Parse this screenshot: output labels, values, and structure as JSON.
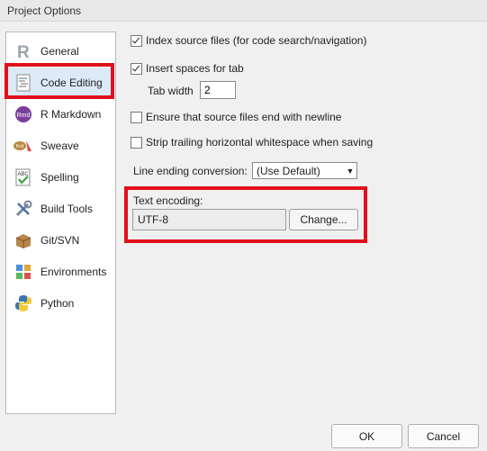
{
  "window": {
    "title": "Project Options"
  },
  "sidebar": {
    "items": [
      {
        "label": "General",
        "icon": "r-logo-icon"
      },
      {
        "label": "Code Editing",
        "icon": "code-document-icon",
        "selected": true
      },
      {
        "label": "R Markdown",
        "icon": "rmd-icon"
      },
      {
        "label": "Sweave",
        "icon": "sweave-icon"
      },
      {
        "label": "Spelling",
        "icon": "spellcheck-icon"
      },
      {
        "label": "Build Tools",
        "icon": "tools-icon"
      },
      {
        "label": "Git/SVN",
        "icon": "git-box-icon"
      },
      {
        "label": "Environments",
        "icon": "environments-icon"
      },
      {
        "label": "Python",
        "icon": "python-icon"
      }
    ]
  },
  "options": {
    "index_source": {
      "label": "Index source files (for code search/navigation)",
      "checked": true
    },
    "insert_spaces": {
      "label": "Insert spaces for tab",
      "checked": true
    },
    "tab_width": {
      "label": "Tab width",
      "value": "2"
    },
    "ensure_newline": {
      "label": "Ensure that source files end with newline",
      "checked": false
    },
    "strip_whitespace": {
      "label": "Strip trailing horizontal whitespace when saving",
      "checked": false
    },
    "line_ending": {
      "label": "Line ending conversion:",
      "value": "(Use Default)"
    },
    "text_encoding": {
      "label": "Text encoding:",
      "value": "UTF-8",
      "button": "Change..."
    }
  },
  "footer": {
    "ok": "OK",
    "cancel": "Cancel"
  },
  "colors": {
    "highlight": "#e0101c",
    "selected_bg": "#dce9f7"
  }
}
